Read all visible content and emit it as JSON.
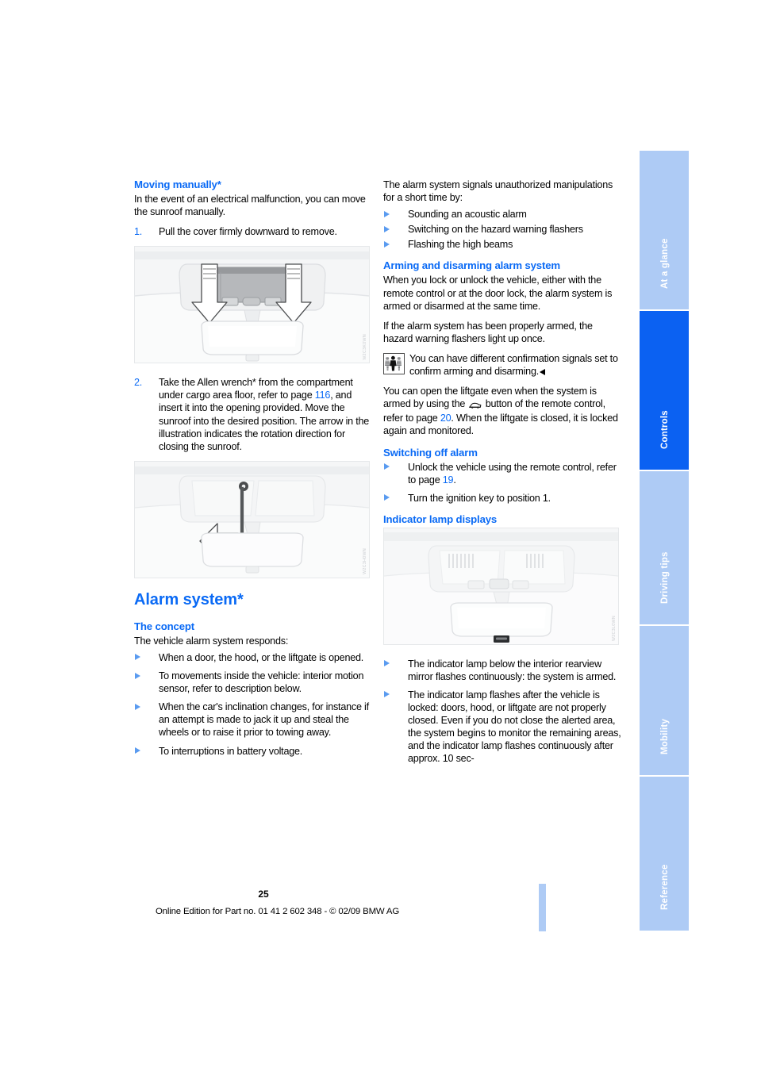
{
  "document": {
    "page_number": "25",
    "footer_note": "Online Edition for Part no. 01 41 2 602 348 - © 02/09 BMW AG"
  },
  "sidebar": {
    "tabs": [
      {
        "label": "At a glance",
        "active": false
      },
      {
        "label": "Controls",
        "active": true
      },
      {
        "label": "Driving tips",
        "active": false
      },
      {
        "label": "Mobility",
        "active": false
      },
      {
        "label": "Reference",
        "active": false
      }
    ]
  },
  "left_column": {
    "heading_moving_manually": "Moving manually*",
    "intro": "In the event of an electrical malfunction, you can move the sunroof manually.",
    "steps": [
      {
        "num": "1.",
        "text": "Pull the cover firmly downward to remove."
      },
      {
        "num": "2.",
        "text_before": "Take the Allen wrench* from the compartment under cargo area floor, refer to page ",
        "page_ref": "116",
        "text_after": ", and insert it into the opening provided. Move the sunroof into the desired position. The arrow in the illustration indicates the rotation direction for closing the sunroof."
      }
    ],
    "figure1_code": "W2C3K0WN",
    "figure2_code": "W2C3H0WN",
    "heading_alarm_system": "Alarm system*",
    "heading_the_concept": "The concept",
    "concept_intro": "The vehicle alarm system responds:",
    "concept_bullets": [
      "When a door, the hood, or the liftgate is opened.",
      "To movements inside the vehicle: interior motion sensor, refer to description below.",
      "When the car's inclination changes, for instance if an attempt is made to jack it up and steal the wheels or to raise it prior to towing away.",
      "To interruptions in battery voltage."
    ]
  },
  "right_column": {
    "signals_intro": "The alarm system signals unauthorized manipulations for a short time by:",
    "signals_bullets": [
      "Sounding an acoustic alarm",
      "Switching on the hazard warning flashers",
      "Flashing the high beams"
    ],
    "heading_arming": "Arming and disarming alarm system",
    "arming_p1": "When you lock or unlock the vehicle, either with the remote control or at the door lock, the alarm system is armed or disarmed at the same time.",
    "arming_p2": "If the alarm system has been properly armed, the hazard warning flashers light up once.",
    "note_text": "You can have different confirmation signals set to confirm arming and disarming.",
    "liftgate_before": "You can open the liftgate even when the system is armed by using the ",
    "liftgate_mid": " button of the remote control, refer to page ",
    "liftgate_page_ref": "20",
    "liftgate_after": ". When the liftgate is closed, it is locked again and monitored.",
    "heading_switching_off": "Switching off alarm",
    "switching_off_bullets": [
      {
        "text_before": "Unlock the vehicle using the remote control, refer to page ",
        "page_ref": "19",
        "text_after": "."
      },
      {
        "text_before": "Turn the ignition key to position 1.",
        "page_ref": "",
        "text_after": ""
      }
    ],
    "heading_indicator": "Indicator lamp displays",
    "figure3_code": "W2C3L0WN",
    "indicator_bullets": [
      "The indicator lamp below the interior rearview mirror flashes continuously: the system is armed.",
      "The indicator lamp flashes after the vehicle is locked: doors, hood, or liftgate are not properly closed. Even if you do not close the alerted area, the system begins to monitor the remaining areas, and the indicator lamp flashes continuously after approx. 10 sec-"
    ]
  },
  "colors": {
    "heading_blue": "#0a6af5",
    "tab_inactive": "#aecbf5",
    "tab_active": "#0b61f2",
    "bullet_blue": "#5a9bf0"
  }
}
